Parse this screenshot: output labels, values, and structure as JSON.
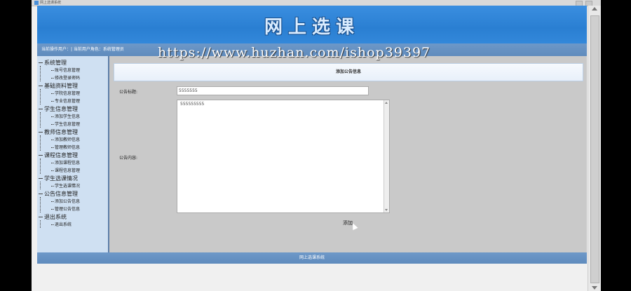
{
  "browser": {
    "tab_title": "网上选课系统"
  },
  "banner": {
    "title": "网上选课"
  },
  "userbar": {
    "text": "当前操作用户：| 当前用户角色：系统管理员"
  },
  "watermark": "https://www.huzhan.com/ishop39397",
  "sidebar": {
    "groups": [
      {
        "label": "系统管理",
        "items": [
          "账号信息管理",
          "修改登录密码"
        ]
      },
      {
        "label": "基础资料管理",
        "items": [
          "学院信息管理",
          "专业信息管理"
        ]
      },
      {
        "label": "学生信息管理",
        "items": [
          "添加学生信息",
          "学生信息管理"
        ]
      },
      {
        "label": "教师信息管理",
        "items": [
          "添加教师信息",
          "管理教师信息"
        ]
      },
      {
        "label": "课程信息管理",
        "items": [
          "添加课程信息",
          "课程信息管理"
        ]
      },
      {
        "label": "学生选课情况",
        "items": [
          "学生选课情况"
        ]
      },
      {
        "label": "公告信息管理",
        "items": [
          "添加公告信息",
          "管理公告信息"
        ]
      },
      {
        "label": "退出系统",
        "items": [
          "退出系统"
        ]
      }
    ]
  },
  "form": {
    "header": "添加公告信息",
    "title_label": "公告标题:",
    "title_value": "5555555",
    "content_label": "公告内容:",
    "content_value": "555555555",
    "submit_label": "添加"
  },
  "footer": {
    "text": "网上选课系统"
  }
}
